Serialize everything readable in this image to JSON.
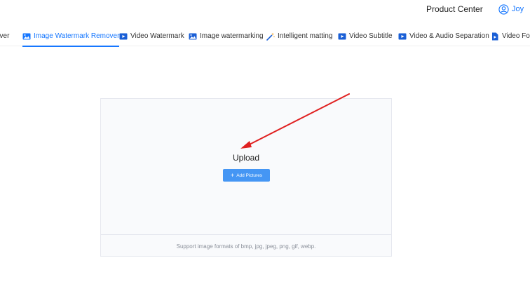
{
  "header": {
    "product_center": "Product Center",
    "user_name": "Joy",
    "accent": "#1677ff"
  },
  "tabs": [
    {
      "label": "over",
      "icon": "image-icon"
    },
    {
      "label": "Image Watermark Remover",
      "icon": "image-icon",
      "active": true
    },
    {
      "label": "Video Watermark",
      "icon": "video-icon"
    },
    {
      "label": "Image watermarking",
      "icon": "image-icon"
    },
    {
      "label": "Intelligent matting",
      "icon": "magic-wand-icon"
    },
    {
      "label": "Video Subtitle",
      "icon": "video-icon"
    },
    {
      "label": "Video & Audio Separation",
      "icon": "video-icon"
    },
    {
      "label": "Video Forr",
      "icon": "video-file-icon"
    }
  ],
  "upload": {
    "title": "Upload",
    "button_label": "Add Pictures",
    "formats_text": "Support image formats of bmp, jpg, jpeg, png, gif, webp.",
    "button_color": "#4596f4"
  },
  "annotation": {
    "arrow_color": "#e02020"
  }
}
